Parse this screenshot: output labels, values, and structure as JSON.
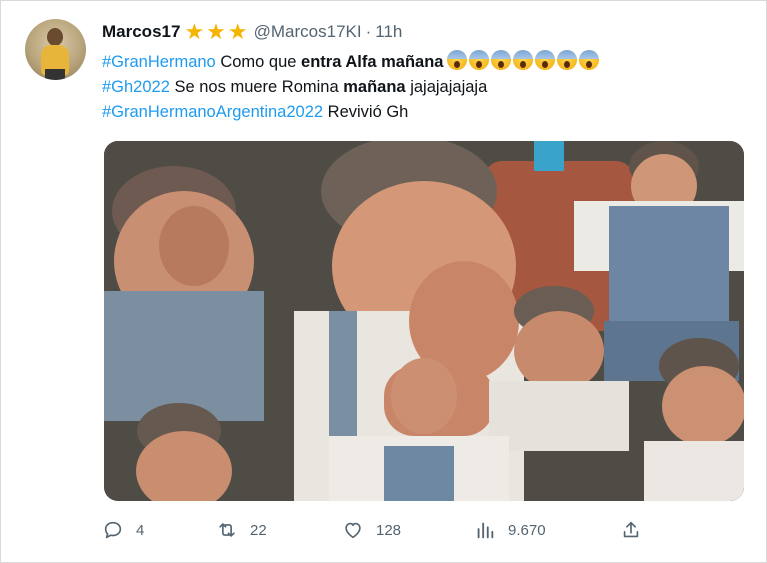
{
  "tweet": {
    "display_name": "Marcos17",
    "badge_icons": [
      "star-icon",
      "star-icon",
      "star-icon"
    ],
    "handle": "@Marcos17KI",
    "separator": "·",
    "time": "11h",
    "lines": [
      {
        "hashtag": "#GranHermano",
        "text1": " Como que ",
        "bold": "entra Alfa mañana",
        "emoji_count": 7
      },
      {
        "hashtag": "#Gh2022",
        "text1": " Se nos muere Romina ",
        "bold": "mañana",
        "text2": " jajajajajaja"
      },
      {
        "hashtag": "#GranHermanoArgentina2022",
        "text1": " Revivió Gh"
      }
    ]
  },
  "media": {
    "type": "image",
    "icon": "meme-collage-image"
  },
  "actions": {
    "reply": {
      "icon": "reply-icon",
      "count": "4"
    },
    "retweet": {
      "icon": "retweet-icon",
      "count": "22"
    },
    "like": {
      "icon": "heart-icon",
      "count": "128"
    },
    "views": {
      "icon": "views-icon",
      "count": "9.670"
    },
    "share": {
      "icon": "share-icon"
    }
  },
  "colors": {
    "link": "#1d9bf0",
    "muted": "#536471",
    "star": "#f4b400"
  }
}
